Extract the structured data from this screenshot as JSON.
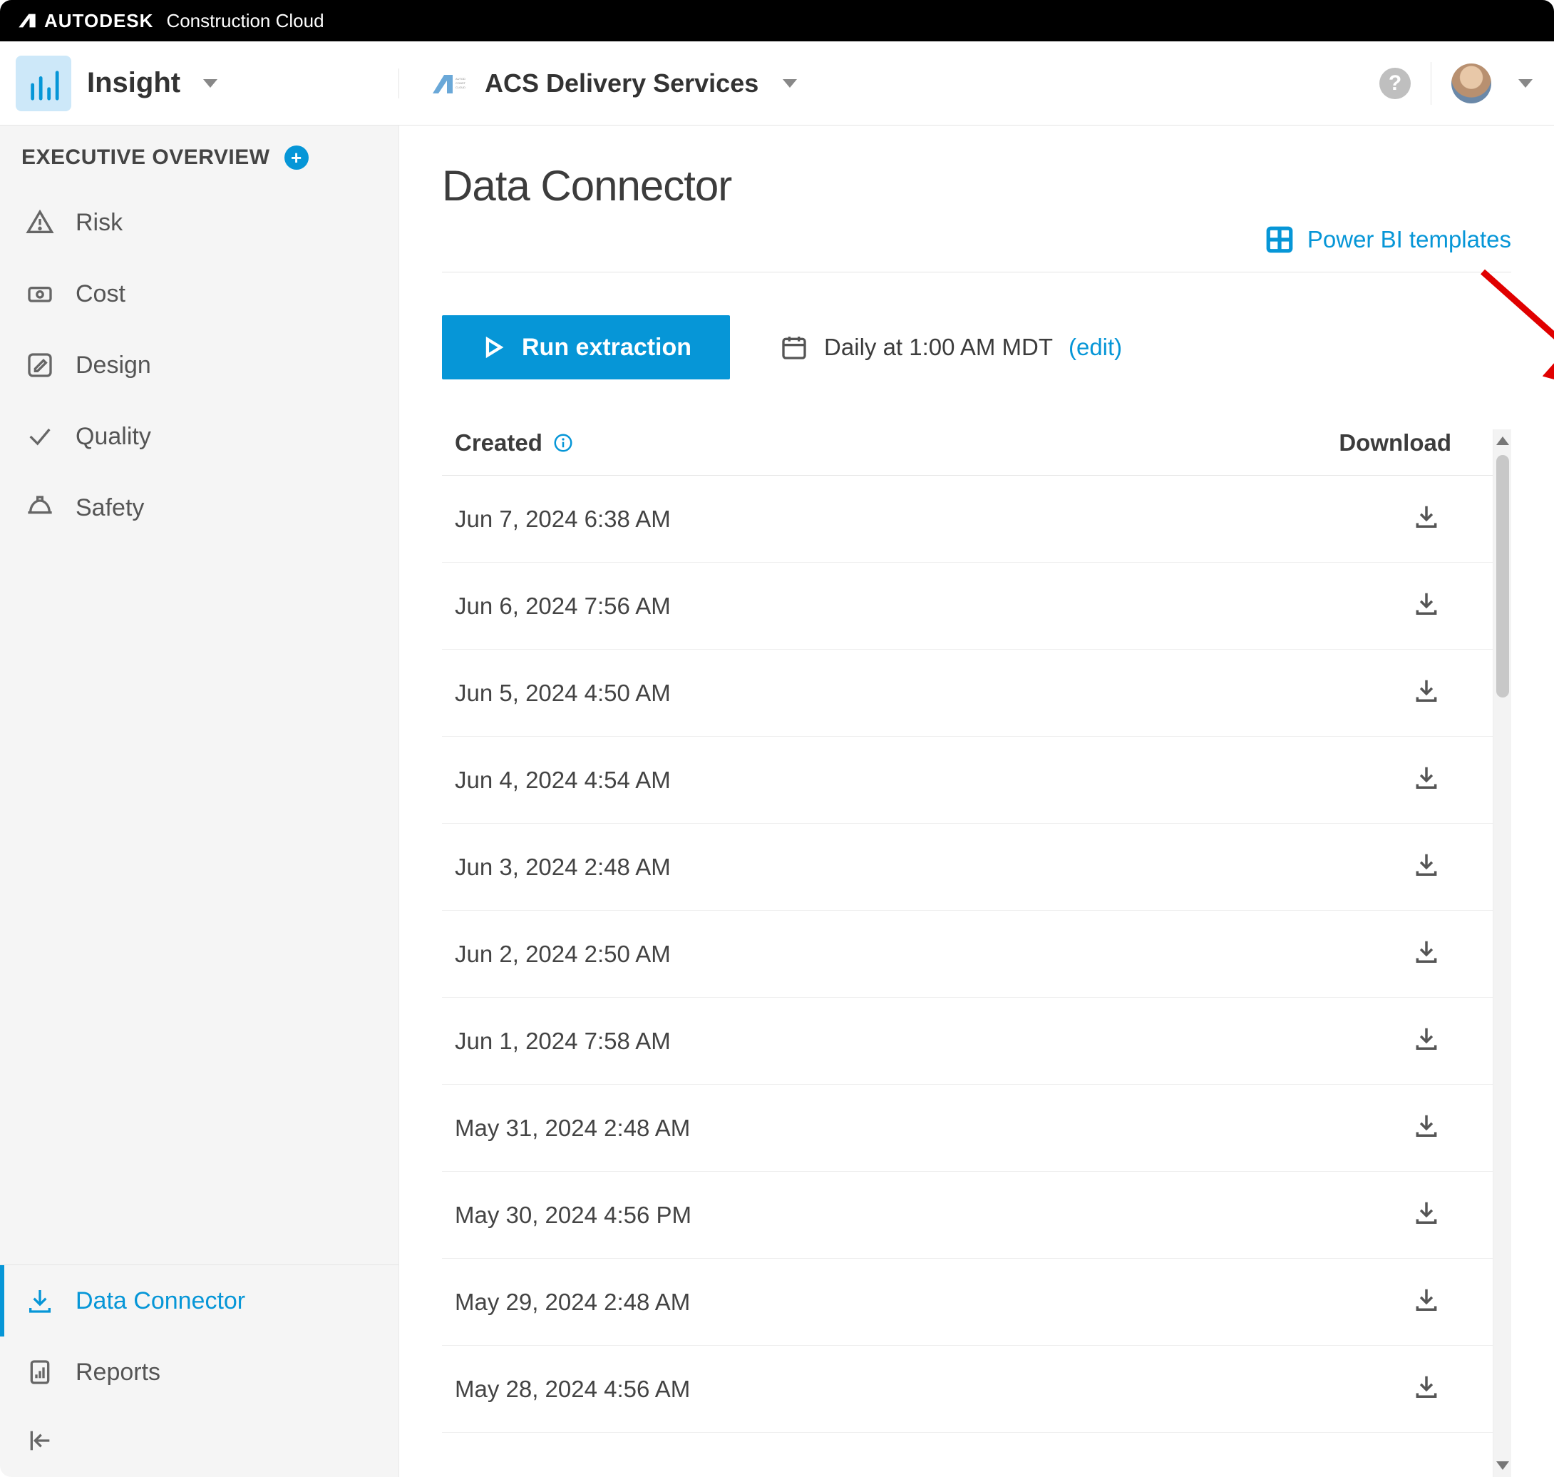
{
  "brand": {
    "strong": "AUTODESK",
    "light": "Construction Cloud"
  },
  "header": {
    "app_name": "Insight",
    "project_name": "ACS Delivery Services"
  },
  "sidebar": {
    "section_title": "EXECUTIVE OVERVIEW",
    "items": [
      {
        "label": "Risk"
      },
      {
        "label": "Cost"
      },
      {
        "label": "Design"
      },
      {
        "label": "Quality"
      },
      {
        "label": "Safety"
      }
    ],
    "bottom": [
      {
        "label": "Data Connector",
        "active": true
      },
      {
        "label": "Reports",
        "active": false
      }
    ]
  },
  "main": {
    "title": "Data Connector",
    "powerbi_label": "Power BI templates",
    "run_label": "Run extraction",
    "schedule_text": "Daily at 1:00 AM MDT",
    "edit_label": "(edit)",
    "columns": {
      "created": "Created",
      "download": "Download"
    },
    "rows": [
      {
        "created": "Jun 7, 2024 6:38 AM"
      },
      {
        "created": "Jun 6, 2024 7:56 AM"
      },
      {
        "created": "Jun 5, 2024 4:50 AM"
      },
      {
        "created": "Jun 4, 2024 4:54 AM"
      },
      {
        "created": "Jun 3, 2024 2:48 AM"
      },
      {
        "created": "Jun 2, 2024 2:50 AM"
      },
      {
        "created": "Jun 1, 2024 7:58 AM"
      },
      {
        "created": "May 31, 2024 2:48 AM"
      },
      {
        "created": "May 30, 2024 4:56 PM"
      },
      {
        "created": "May 29, 2024 2:48 AM"
      },
      {
        "created": "May 28, 2024 4:56 AM"
      }
    ]
  }
}
